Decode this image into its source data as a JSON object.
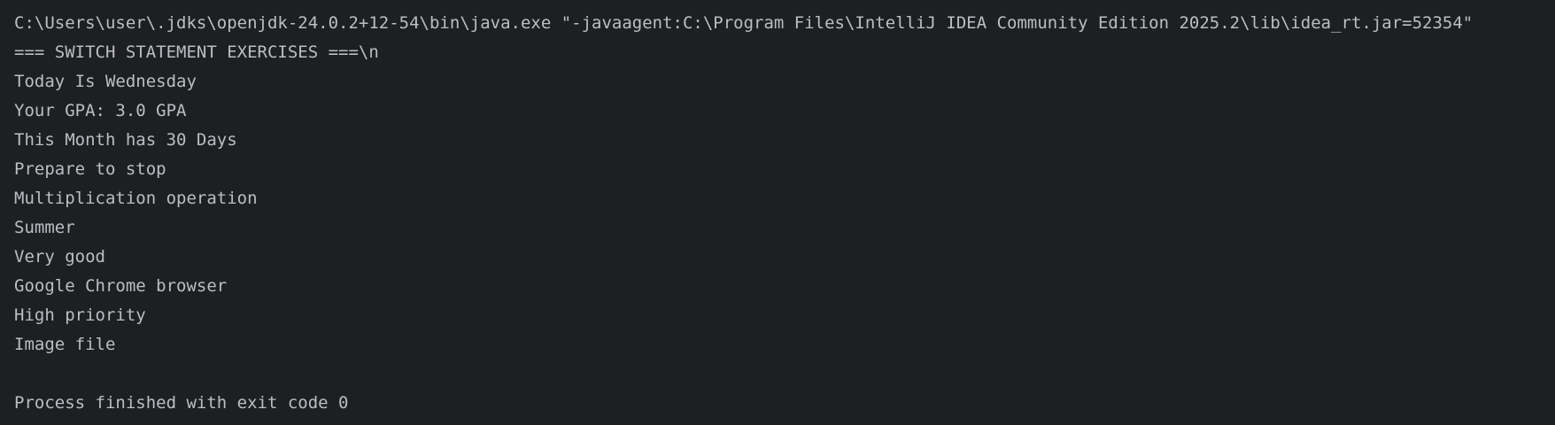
{
  "console": {
    "lines": [
      "C:\\Users\\user\\.jdks\\openjdk-24.0.2+12-54\\bin\\java.exe \"-javaagent:C:\\Program Files\\IntelliJ IDEA Community Edition 2025.2\\lib\\idea_rt.jar=52354\"",
      "=== SWITCH STATEMENT EXERCISES ===\\n",
      "Today Is Wednesday",
      "Your GPA: 3.0 GPA",
      "This Month has 30 Days",
      "Prepare to stop",
      "Multiplication operation",
      "Summer",
      "Very good",
      "Google Chrome browser",
      "High priority",
      "Image file",
      "",
      "Process finished with exit code 0"
    ]
  },
  "colors": {
    "background": "#1e1f22",
    "text": "#bcbec4"
  }
}
